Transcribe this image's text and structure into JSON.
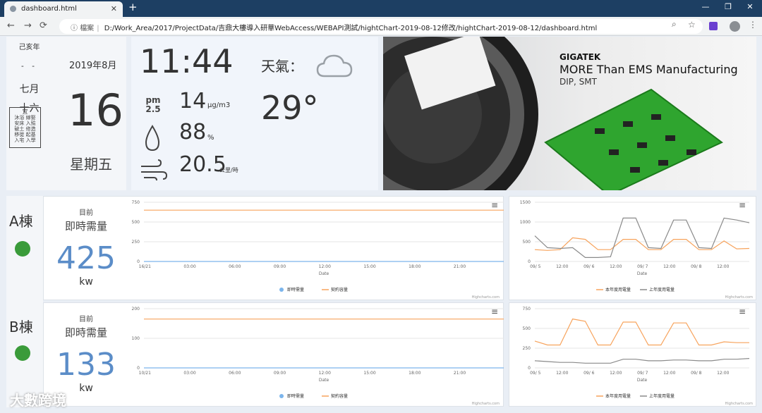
{
  "browser": {
    "tab_title": "dashboard.html",
    "close": "✕",
    "new_tab": "+",
    "min": "—",
    "max": "❐",
    "close_win": "✕",
    "back": "←",
    "forward": "→",
    "reload": "⟳",
    "info": "ⓘ",
    "file_label": "檔案",
    "url": "D:/Work_Area/2017/ProjectData/吉鼎大樓導入研華WebAccess/WEBAPI測試/hightChart-2019-08-12修改/hightChart-2019-08-12/dashboard.html",
    "zoom": "⌕",
    "star": "☆",
    "menu": "⋮"
  },
  "calendar": {
    "lunar_year": "己亥年",
    "lunar_dash": "- -",
    "lunar_month": "七月",
    "lunar_day": "十六",
    "yi_title": "宜",
    "yi_items": "沐浴 嫁娶 安床 入殮 破土 修造 移徙 起基 入宅 入學",
    "year_month": "2019年8月",
    "day": "16",
    "weekday": "星期五"
  },
  "weather": {
    "time": "11:44",
    "label": "天氣：",
    "temp": "29°",
    "pm_label": "pm 2.5",
    "pm_value": "14",
    "pm_unit": "μg/m3",
    "humidity": "88",
    "humidity_unit": "%",
    "wind": "20.5",
    "wind_unit": "公里/時"
  },
  "banner": {
    "company": "GIGATEK",
    "tagline": "MORE Than EMS Manufacturing",
    "sub": "DIP, SMT"
  },
  "buildings": [
    {
      "name": "A棟",
      "sub": "目前",
      "title": "即時需量",
      "value": "425",
      "unit": "kw"
    },
    {
      "name": "B棟",
      "sub": "目前",
      "title": "即時需量",
      "value": "133",
      "unit": "kw"
    }
  ],
  "colors": {
    "blue": "#7cb5ec",
    "orange": "#f7a35c",
    "gray": "#8a8a8a",
    "led": "#3a9b3a"
  },
  "credits": "Highcharts.com",
  "watermark": "大數跨境",
  "chart_data": [
    {
      "type": "line",
      "building": "A棟",
      "xlabel": "Date",
      "x_ticks": [
        "16/21",
        "03:00",
        "06:00",
        "09:00",
        "12:00",
        "15:00",
        "18:00",
        "21:00"
      ],
      "ylim": [
        0,
        750
      ],
      "y_ticks": [
        0,
        250,
        500,
        750
      ],
      "series": [
        {
          "name": "即時需量",
          "color": "#7cb5ec",
          "values": [
            0,
            0,
            0,
            0,
            0,
            0,
            0,
            0
          ]
        },
        {
          "name": "契約容量",
          "color": "#f7a35c",
          "values": [
            650,
            650,
            650,
            650,
            650,
            650,
            650,
            650
          ]
        }
      ]
    },
    {
      "type": "line",
      "building": "A棟",
      "xlabel": "Date",
      "x_ticks": [
        "09/ 5",
        "12:00",
        "09/ 6",
        "12:00",
        "09/ 7",
        "12:00",
        "09/ 8",
        "12:00"
      ],
      "ylim": [
        0,
        1500
      ],
      "y_ticks": [
        0,
        500,
        1000,
        1500
      ],
      "series": [
        {
          "name": "本年度用電量",
          "color": "#f7a35c",
          "values": [
            300,
            280,
            300,
            600,
            560,
            300,
            300,
            560,
            560,
            300,
            300,
            560,
            560,
            300,
            300,
            520,
            320,
            330
          ]
        },
        {
          "name": "上年度用電量",
          "color": "#8a8a8a",
          "values": [
            650,
            350,
            330,
            350,
            100,
            100,
            120,
            1100,
            1100,
            350,
            330,
            1050,
            1050,
            350,
            330,
            1100,
            1050,
            980
          ]
        }
      ]
    },
    {
      "type": "line",
      "building": "B棟",
      "xlabel": "Date",
      "x_ticks": [
        "10/21",
        "03:00",
        "06:00",
        "09:00",
        "12:00",
        "15:00",
        "18:00",
        "21:00"
      ],
      "ylim": [
        0,
        200
      ],
      "y_ticks": [
        0,
        100,
        200
      ],
      "series": [
        {
          "name": "即時需量",
          "color": "#7cb5ec",
          "values": [
            0,
            0,
            0,
            0,
            0,
            0,
            0,
            0
          ]
        },
        {
          "name": "契約容量",
          "color": "#f7a35c",
          "values": [
            165,
            165,
            165,
            165,
            165,
            165,
            165,
            165
          ]
        }
      ]
    },
    {
      "type": "line",
      "building": "B棟",
      "xlabel": "Date",
      "x_ticks": [
        "09/ 5",
        "12:00",
        "09/ 6",
        "12:00",
        "09/ 7",
        "12:00",
        "09/ 8",
        "12:00"
      ],
      "ylim": [
        0,
        750
      ],
      "y_ticks": [
        0,
        250,
        500,
        750
      ],
      "series": [
        {
          "name": "本年度用電量",
          "color": "#f7a35c",
          "values": [
            340,
            290,
            290,
            620,
            590,
            290,
            290,
            580,
            580,
            290,
            290,
            570,
            570,
            290,
            290,
            330,
            320,
            320
          ]
        },
        {
          "name": "上年度用電量",
          "color": "#8a8a8a",
          "values": [
            90,
            80,
            70,
            70,
            60,
            60,
            60,
            110,
            110,
            90,
            90,
            100,
            100,
            90,
            90,
            110,
            110,
            120
          ]
        }
      ]
    }
  ]
}
